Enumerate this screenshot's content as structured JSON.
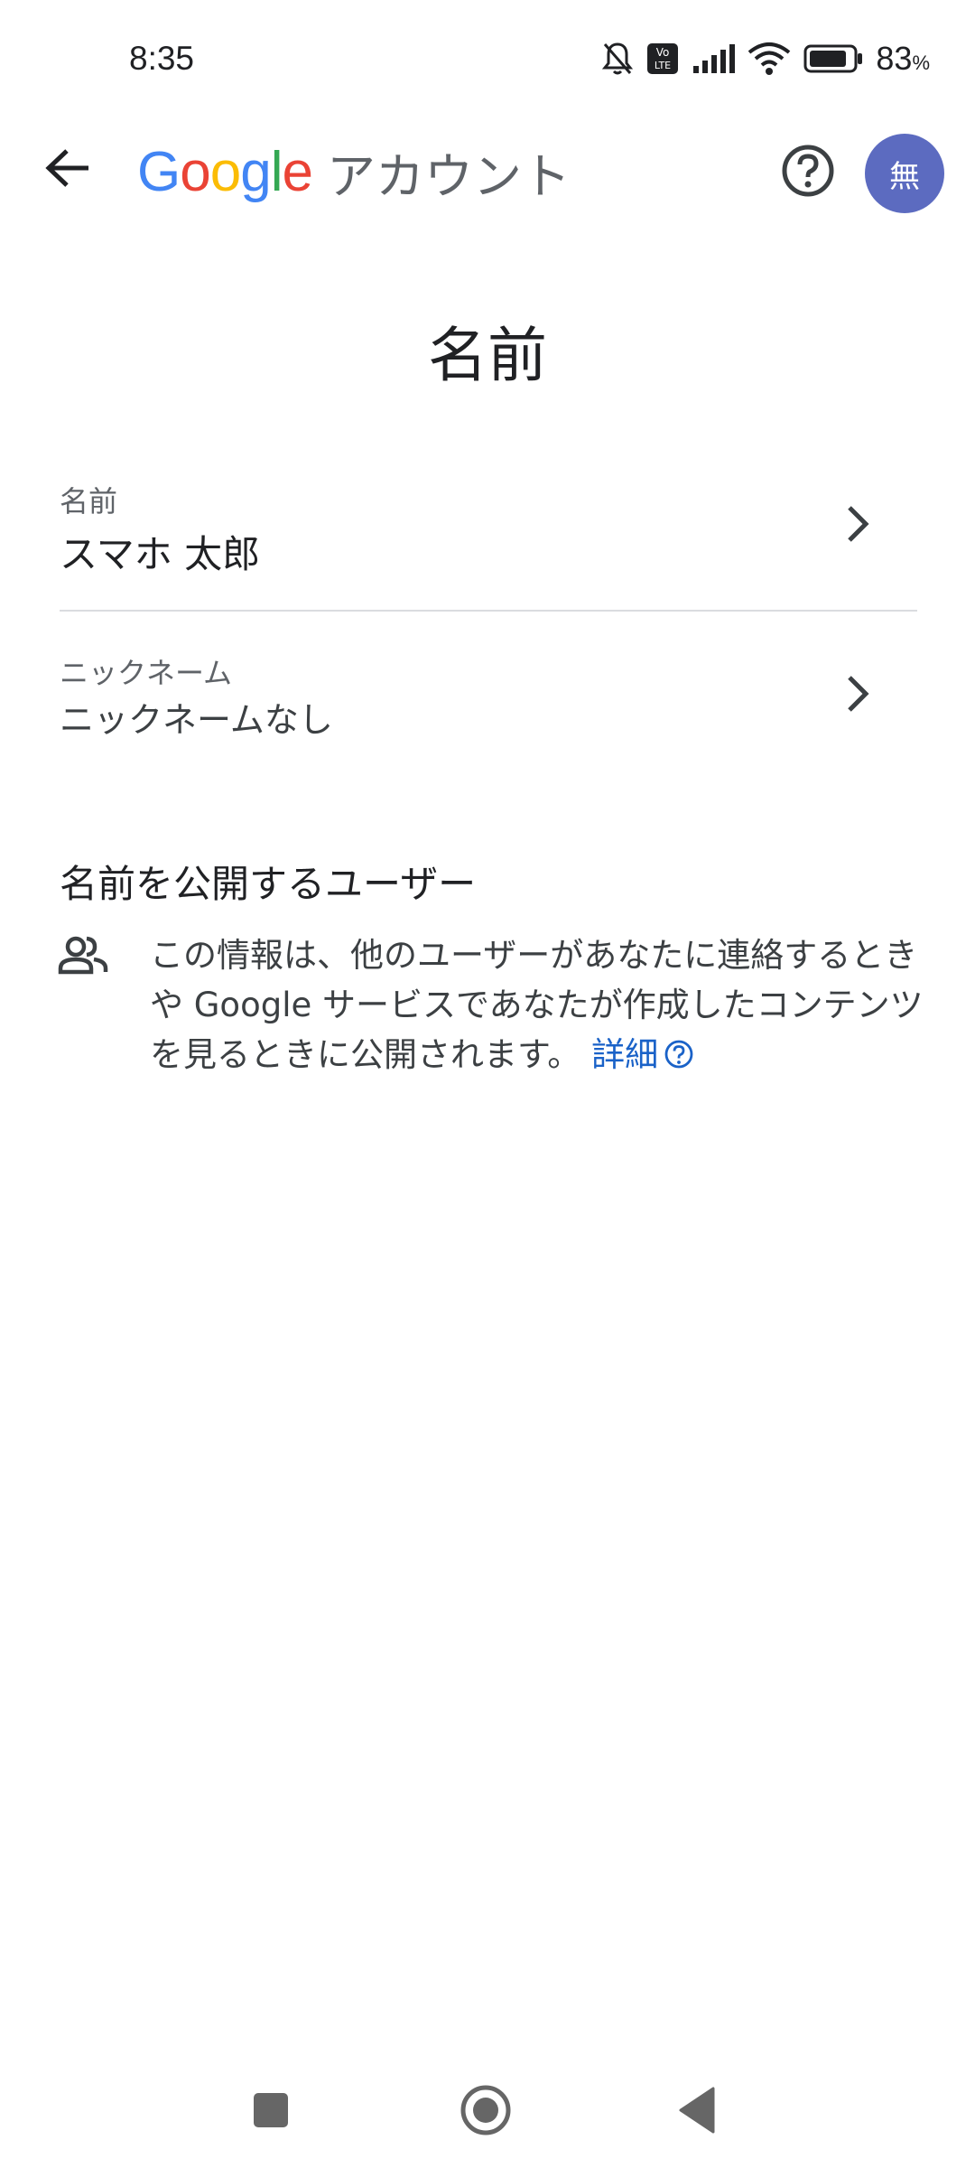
{
  "status_bar": {
    "time": "8:35",
    "battery_percent": "83",
    "battery_unit": "%",
    "icons": [
      "bell-off-icon",
      "volte-icon",
      "signal-icon",
      "wifi-icon",
      "battery-icon"
    ]
  },
  "app_bar": {
    "brand_letters": [
      "G",
      "o",
      "o",
      "g",
      "l",
      "e"
    ],
    "brand_colors": [
      "#4285F4",
      "#EA4335",
      "#FBBC05",
      "#4285F4",
      "#34A853",
      "#EA4335"
    ],
    "title_suffix": "アカウント",
    "avatar_initial": "無",
    "avatar_color": "#5c6bc0"
  },
  "page": {
    "title": "名前"
  },
  "rows": [
    {
      "label": "名前",
      "value": "スマホ 太郎"
    },
    {
      "label": "ニックネーム",
      "value": "ニックネームなし"
    }
  ],
  "visibility_section": {
    "title": "名前を公開するユーザー",
    "description": "この情報は、他のユーザーがあなたに連絡するときや Google サービスであなたが作成したコンテンツを見るときに公開されます。",
    "link_label": "詳細",
    "link_color": "#1a62c8"
  },
  "nav_bar": {
    "buttons": [
      "recents-button",
      "home-button",
      "back-button"
    ]
  }
}
